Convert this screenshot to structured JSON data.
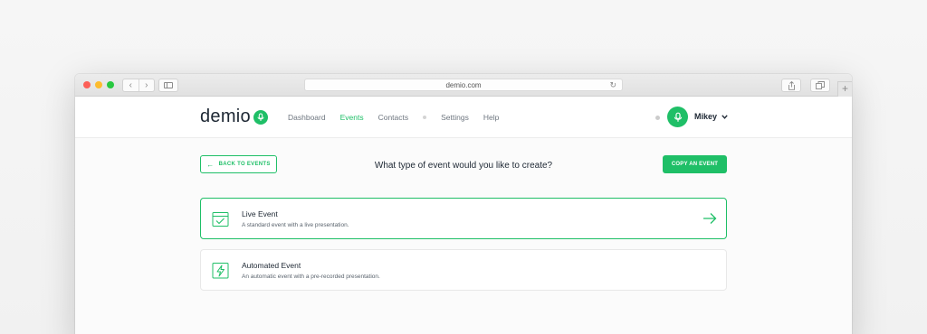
{
  "browser": {
    "url": "demio.com"
  },
  "app": {
    "logo_text": "demio",
    "nav": [
      {
        "label": "Dashboard",
        "active": false
      },
      {
        "label": "Events",
        "active": true
      },
      {
        "label": "Contacts",
        "active": false
      },
      {
        "label": "Settings",
        "active": false
      },
      {
        "label": "Help",
        "active": false
      }
    ],
    "user_name": "Mikey"
  },
  "toolbar": {
    "back_label": "BACK TO EVENTS",
    "question": "What type of event would you like to create?",
    "copy_label": "COPY AN EVENT"
  },
  "cards": [
    {
      "title": "Live Event",
      "description": "A standard event with a live presentation.",
      "icon": "calendar-check-icon",
      "selected": true
    },
    {
      "title": "Automated Event",
      "description": "An automatic event with a pre-recorded presentation.",
      "icon": "lightning-icon",
      "selected": false
    }
  ],
  "colors": {
    "accent": "#1fbf67",
    "text": "#1d2733"
  }
}
